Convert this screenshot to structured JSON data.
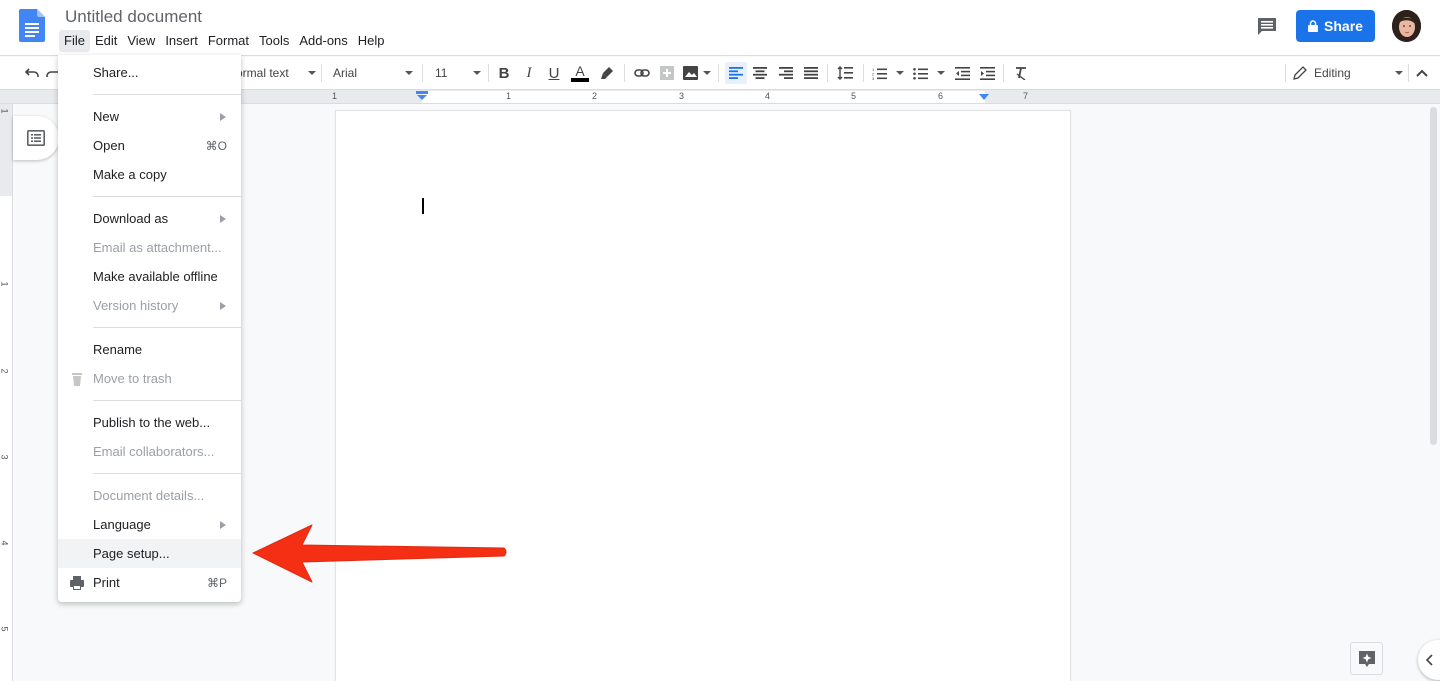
{
  "header": {
    "title": "Untitled document",
    "menus": [
      "File",
      "Edit",
      "View",
      "Insert",
      "Format",
      "Tools",
      "Add-ons",
      "Help"
    ],
    "active_menu": "File",
    "share_label": "Share",
    "icons": {
      "logo": "docs-logo-icon",
      "comments": "comments-icon",
      "lock": "lock-icon"
    }
  },
  "toolbar": {
    "style_value": "Normal text",
    "style_visible": "ormal text",
    "font_value": "Arial",
    "size_value": "11",
    "mode_label": "Editing",
    "text_color": "#000000"
  },
  "ruler": {
    "horizontal_labels": [
      "1",
      "1",
      "2",
      "3",
      "4",
      "5",
      "6",
      "7"
    ],
    "vertical_labels": [
      "1",
      "1",
      "2",
      "3",
      "4",
      "5"
    ]
  },
  "file_menu": {
    "groups": [
      [
        {
          "label": "Share...",
          "enabled": true
        }
      ],
      [
        {
          "label": "New",
          "enabled": true,
          "submenu": true
        },
        {
          "label": "Open",
          "enabled": true,
          "shortcut": "⌘O"
        },
        {
          "label": "Make a copy",
          "enabled": true
        }
      ],
      [
        {
          "label": "Download as",
          "enabled": true,
          "submenu": true
        },
        {
          "label": "Email as attachment...",
          "enabled": false
        },
        {
          "label": "Make available offline",
          "enabled": true
        },
        {
          "label": "Version history",
          "enabled": false,
          "submenu": true
        }
      ],
      [
        {
          "label": "Rename",
          "enabled": true
        },
        {
          "label": "Move to trash",
          "enabled": false,
          "icon": "trash-icon"
        }
      ],
      [
        {
          "label": "Publish to the web...",
          "enabled": true
        },
        {
          "label": "Email collaborators...",
          "enabled": false
        }
      ],
      [
        {
          "label": "Document details...",
          "enabled": false
        },
        {
          "label": "Language",
          "enabled": true,
          "submenu": true
        },
        {
          "label": "Page setup...",
          "enabled": true,
          "highlighted": true
        },
        {
          "label": "Print",
          "enabled": true,
          "shortcut": "⌘P",
          "icon": "print-icon"
        }
      ]
    ]
  },
  "annotation": {
    "type": "arrow",
    "color": "#f42f14",
    "points_to": "Page setup..."
  },
  "colors": {
    "accent": "#1a73e8",
    "active_align": "#1a73e8"
  }
}
